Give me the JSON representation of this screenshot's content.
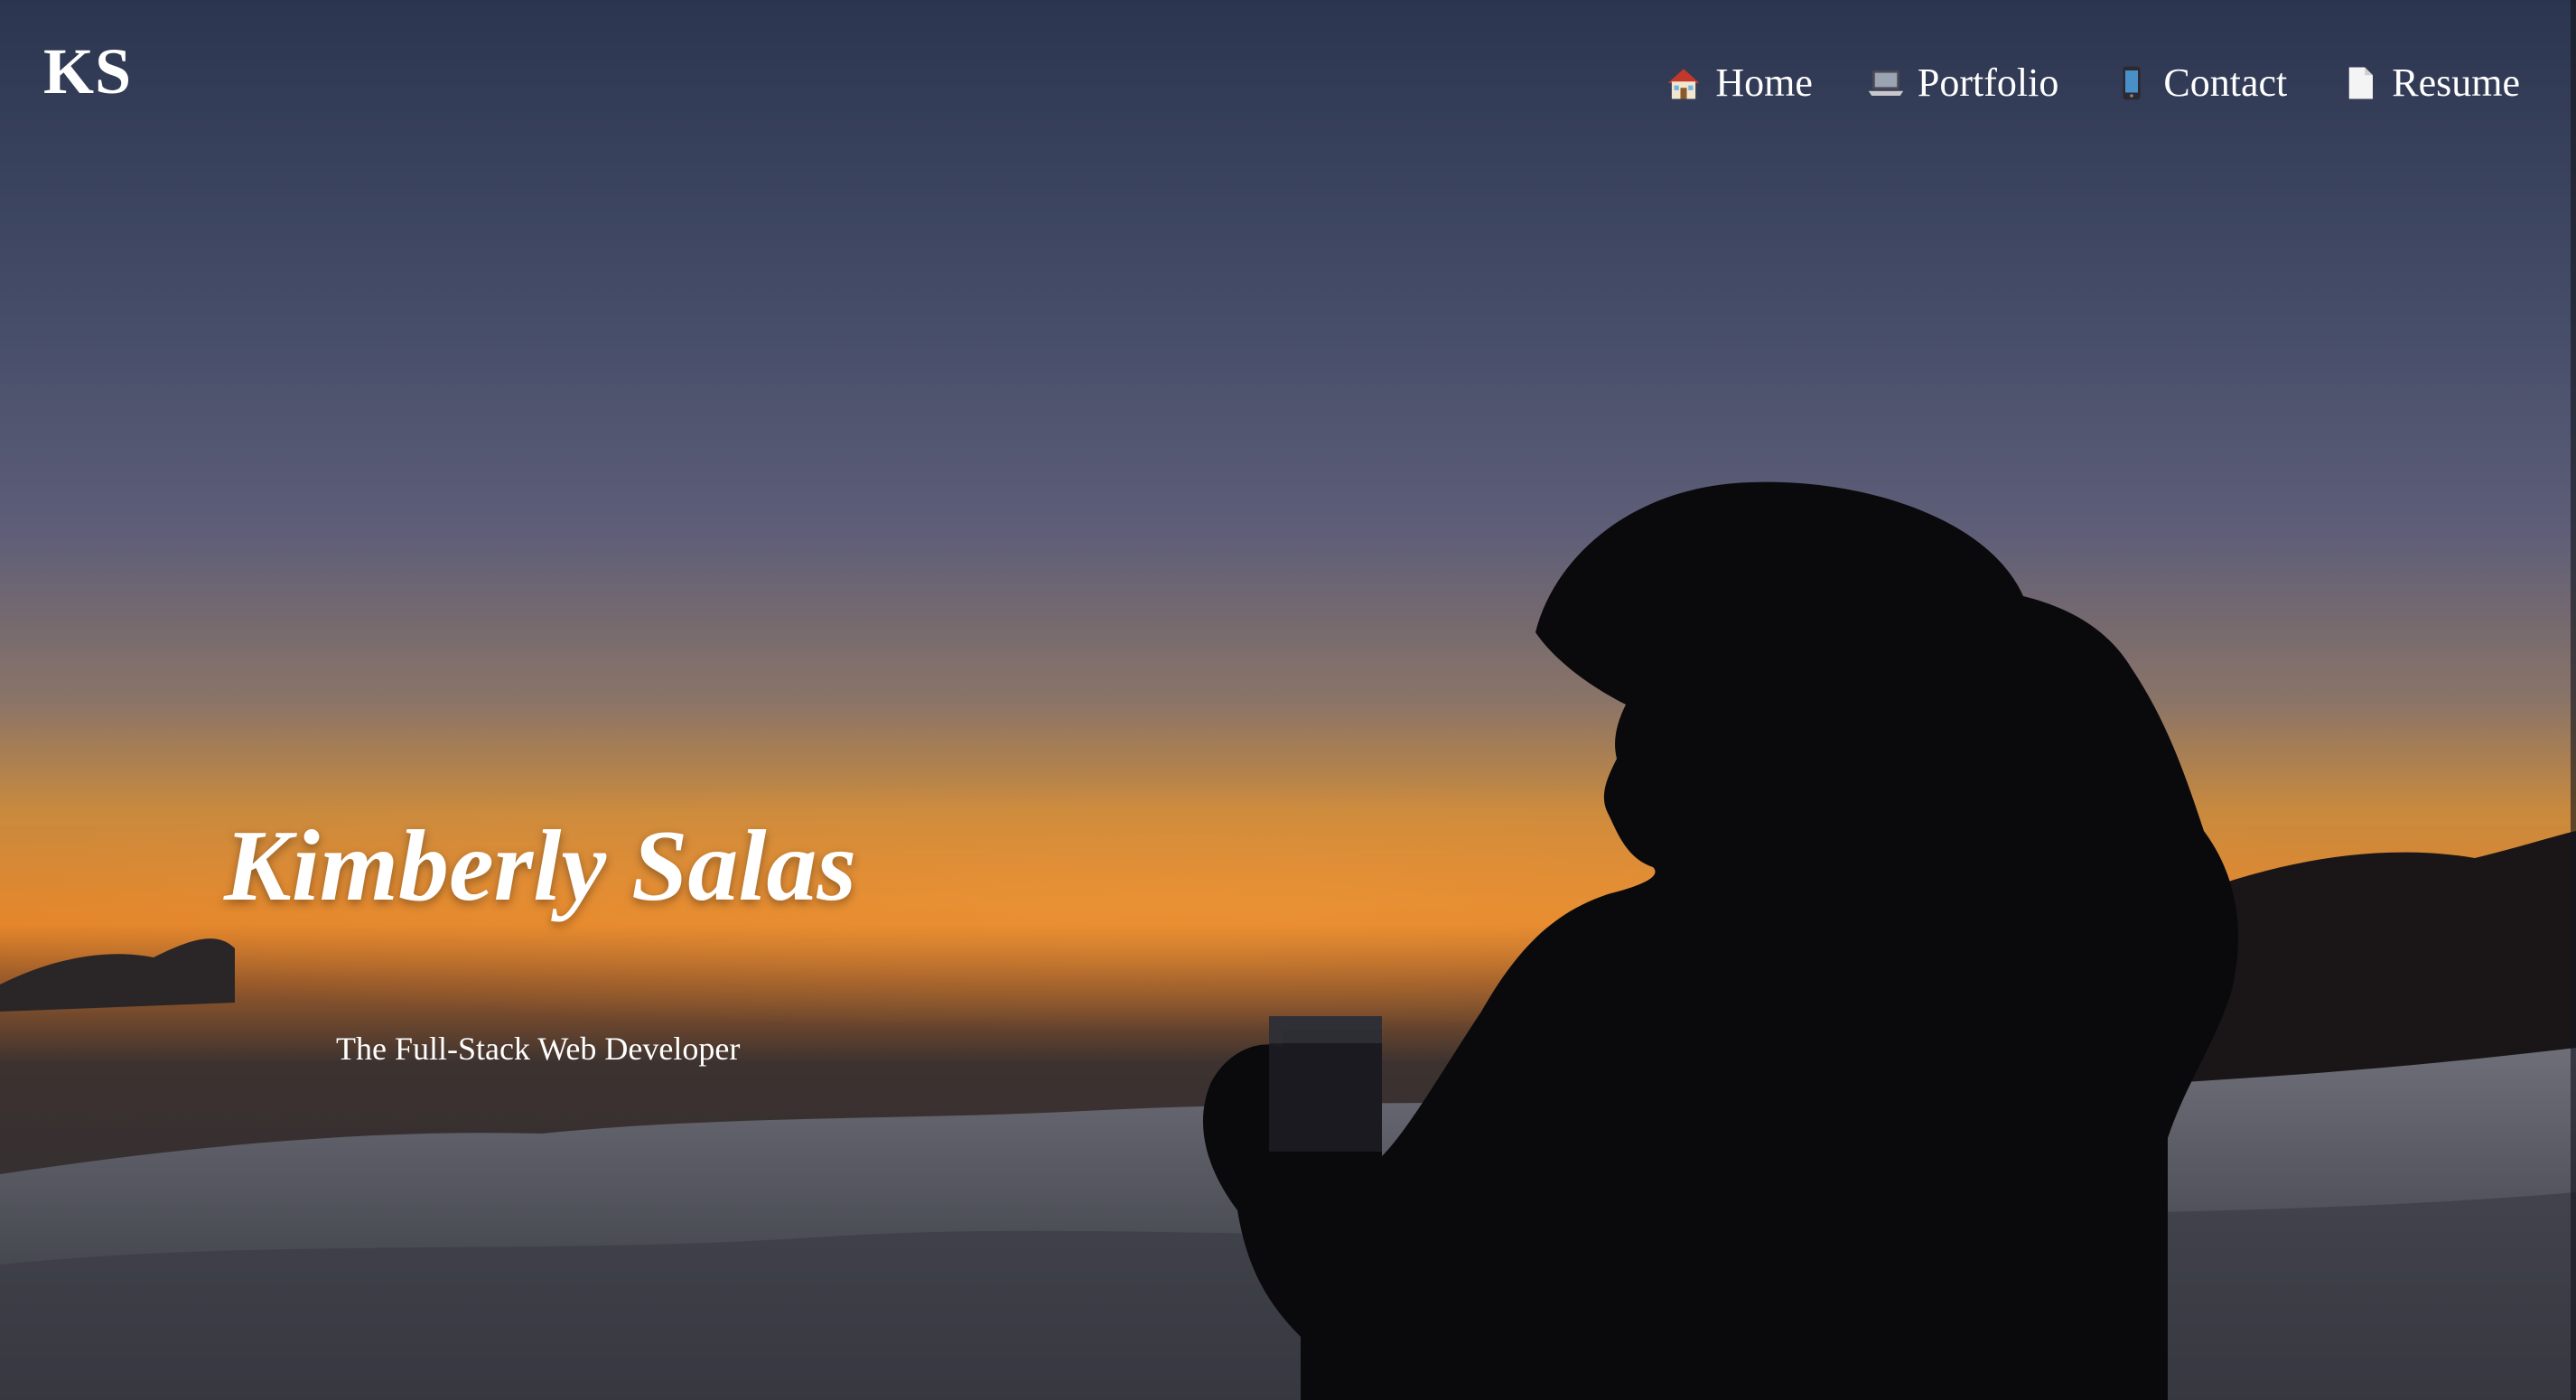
{
  "brand": {
    "logo_text": "KS"
  },
  "nav": {
    "items": [
      {
        "label": "Home",
        "icon": "house-icon"
      },
      {
        "label": "Portfolio",
        "icon": "laptop-icon"
      },
      {
        "label": "Contact",
        "icon": "mobile-phone-icon"
      },
      {
        "label": "Resume",
        "icon": "document-icon"
      }
    ]
  },
  "hero": {
    "name": "Kimberly Salas",
    "subtitle": "The Full-Stack Web Developer"
  },
  "colors": {
    "sky_top": "#2f3a52",
    "sky_mid": "#4a5270",
    "horizon_glow": "#e08a2a",
    "clouds": "#8a8c96",
    "silhouette": "#0b0b0e",
    "text": "#ffffff"
  }
}
